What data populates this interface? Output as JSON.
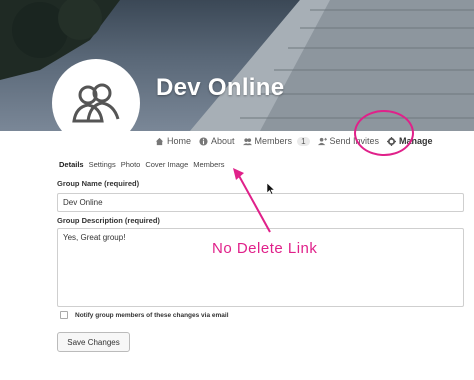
{
  "group": {
    "name": "Dev Online"
  },
  "nav": {
    "items": [
      {
        "label": "Home",
        "icon": "home-icon"
      },
      {
        "label": "About",
        "icon": "info-icon"
      },
      {
        "label": "Members",
        "icon": "members-icon",
        "count": "1"
      },
      {
        "label": "Send Invites",
        "icon": "send-invites-icon"
      },
      {
        "label": "Manage",
        "icon": "gear-icon",
        "active": true
      }
    ]
  },
  "sub_tabs": [
    {
      "label": "Details",
      "active": true
    },
    {
      "label": "Settings"
    },
    {
      "label": "Photo"
    },
    {
      "label": "Cover Image"
    },
    {
      "label": "Members"
    }
  ],
  "form": {
    "name_label": "Group Name (required)",
    "name_value": "Dev Online",
    "desc_label": "Group Description (required)",
    "desc_value": "Yes, Great group!",
    "notify_label": "Notify group members of these changes via email",
    "save_label": "Save Changes"
  },
  "annotation": {
    "text": "No Delete Link",
    "color": "#e0218a"
  }
}
